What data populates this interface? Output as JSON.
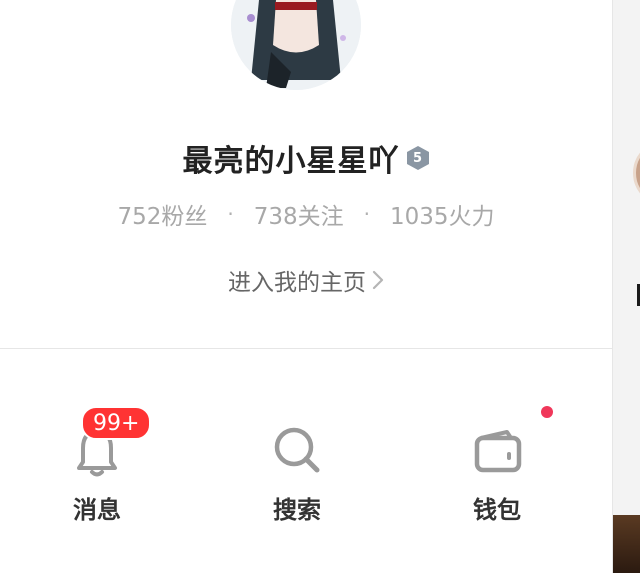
{
  "profile": {
    "username": "最亮的小星星吖",
    "level": "5"
  },
  "stats": {
    "fans": "752粉丝",
    "following": "738关注",
    "fire": "1035火力",
    "separator": "·"
  },
  "homepage_link": {
    "label": "进入我的主页"
  },
  "actions": {
    "messages": {
      "label": "消息",
      "badge": "99+",
      "icon": "bell-icon"
    },
    "search": {
      "label": "搜索",
      "icon": "search-icon"
    },
    "wallet": {
      "label": "钱包",
      "icon": "wallet-icon"
    }
  },
  "colors": {
    "badge_red": "#ff3333",
    "dot_pink": "#f0375a",
    "level_badge": "#8a96a3"
  }
}
